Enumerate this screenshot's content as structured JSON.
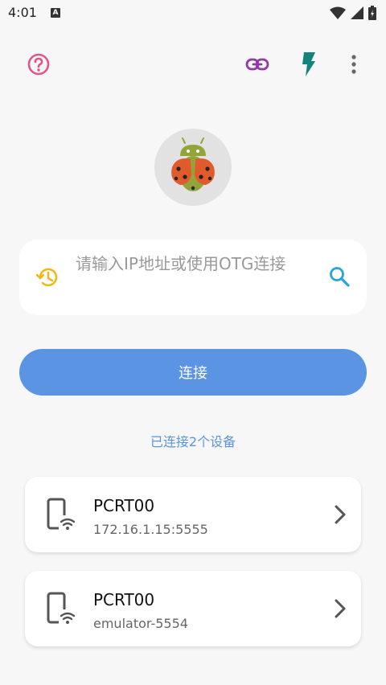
{
  "status_bar": {
    "time": "4:01",
    "notification_badge": "A",
    "icons": [
      "wifi-icon",
      "signal-icon",
      "battery-icon"
    ]
  },
  "toolbar": {
    "icons": [
      "help-icon",
      "link-icon",
      "flash-icon",
      "more-vert-icon"
    ],
    "colors": {
      "help": "#e2558a",
      "link": "#8e3aa8",
      "flash": "#12847c",
      "more": "#666666"
    }
  },
  "search": {
    "placeholder": "请输入IP地址或使用OTG连接",
    "history_icon": "history-icon",
    "search_icon": "search-icon"
  },
  "connect_button": {
    "label": "连接"
  },
  "connected_text": "已连接2个设备",
  "devices": [
    {
      "name": "PCRT00",
      "address": "172.16.1.15:5555",
      "icon": "phone-wifi-icon"
    },
    {
      "name": "PCRT00",
      "address": "emulator-5554",
      "icon": "phone-wifi-icon"
    }
  ],
  "colors": {
    "accent": "#5a94e2",
    "background": "#f7f7f7",
    "card": "#ffffff"
  }
}
